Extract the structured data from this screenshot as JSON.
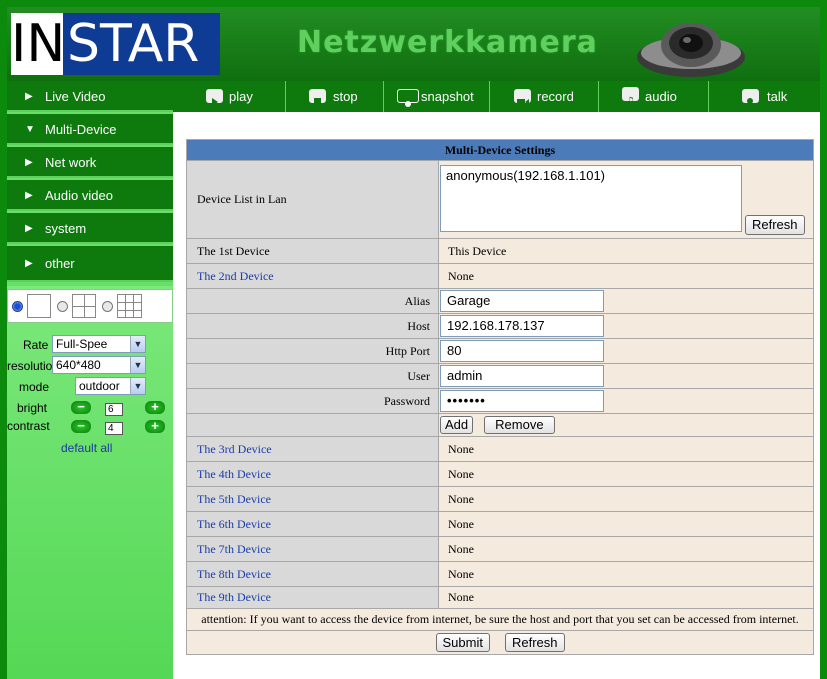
{
  "header": {
    "logo_in": "IN",
    "logo_star": "STAR",
    "title": "Netzwerkkamera"
  },
  "sidebar": {
    "items": [
      {
        "label": "Live Video",
        "arrow": "▶"
      },
      {
        "label": "Multi-Device",
        "arrow": "▼"
      },
      {
        "label": "Net work",
        "arrow": "▶"
      },
      {
        "label": "Audio video",
        "arrow": "▶"
      },
      {
        "label": "system",
        "arrow": "▶"
      },
      {
        "label": "other",
        "arrow": "▶"
      }
    ],
    "controls": {
      "rate_label": "Rate",
      "rate_value": "Full-Spee",
      "resolution_label": "resolution",
      "resolution_value": "640*480",
      "mode_label": "mode",
      "mode_value": "outdoor",
      "bright_label": "bright",
      "bright_value": "6",
      "contrast_label": "contrast",
      "contrast_value": "4",
      "minus": "−",
      "plus": "+",
      "default_all": "default all"
    }
  },
  "toolbar": {
    "play": "play",
    "stop": "stop",
    "snapshot": "snapshot",
    "record": "record",
    "audio": "audio",
    "talk": "talk"
  },
  "settings": {
    "title": "Multi-Device Settings",
    "device_list_label": "Device List in Lan",
    "device_list_entry": "anonymous(192.168.1.101)",
    "refresh": "Refresh",
    "rows": [
      {
        "label": "The 1st Device",
        "value": "This Device"
      },
      {
        "label": "The 2nd Device",
        "value": "None"
      }
    ],
    "fields": {
      "alias_label": "Alias",
      "alias_value": "Garage",
      "host_label": "Host",
      "host_value": "192.168.178.137",
      "port_label": "Http Port",
      "port_value": "80",
      "user_label": "User",
      "user_value": "admin",
      "password_label": "Password",
      "password_value": "•••••••"
    },
    "add": "Add",
    "remove": "Remove",
    "more_rows": [
      {
        "label": "The 3rd Device",
        "value": "None"
      },
      {
        "label": "The 4th Device",
        "value": "None"
      },
      {
        "label": "The 5th Device",
        "value": "None"
      },
      {
        "label": "The 6th Device",
        "value": "None"
      },
      {
        "label": "The 7th Device",
        "value": "None"
      },
      {
        "label": "The 8th Device",
        "value": "None"
      },
      {
        "label": "The 9th Device",
        "value": "None"
      }
    ],
    "attention": "attention: If you want to access the device from internet, be sure the host and port that you set can be accessed from internet.",
    "submit": "Submit",
    "refresh2": "Refresh"
  }
}
